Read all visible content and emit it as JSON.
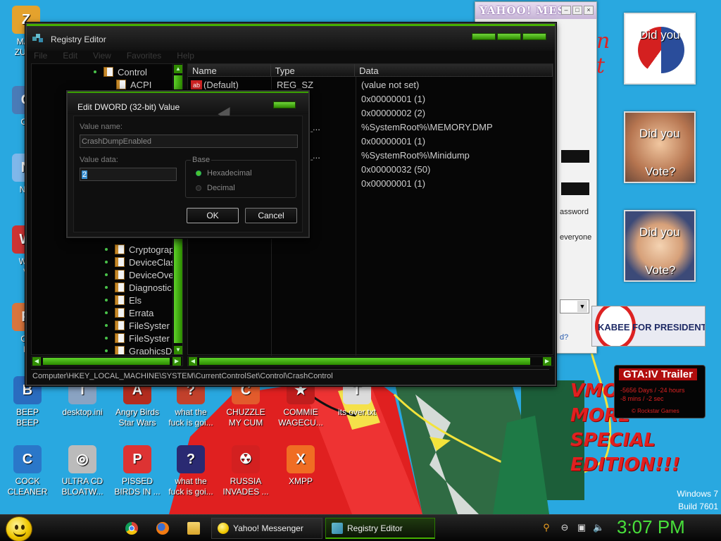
{
  "desktop": {
    "icons": [
      {
        "label": "MAR\nZUCK",
        "color": "#e4a22d",
        "glyph": "Z"
      },
      {
        "label": "Co",
        "color": "#4a7bb7",
        "glyph": "C"
      },
      {
        "label": "Net",
        "color": "#7fb7ea",
        "glyph": "N"
      },
      {
        "label": "Win\nV",
        "color": "#c33",
        "glyph": "W"
      },
      {
        "label": "Co\nP",
        "color": "#d8753d",
        "glyph": "P"
      },
      {
        "label": "BEEP\nBEEP",
        "color": "#2a6cbf",
        "glyph": "B"
      },
      {
        "label": "desktop.ini",
        "color": "#8aa3c2",
        "glyph": "i"
      },
      {
        "label": "Angry Birds\nStar Wars",
        "color": "#b32d1f",
        "glyph": "A"
      },
      {
        "label": "what the\nfuck is goi...",
        "color": "#c2412c",
        "glyph": "?"
      },
      {
        "label": "CHUZZLE\nMY CUM",
        "color": "#e35b2c",
        "glyph": "C"
      },
      {
        "label": "COMMIE\nWAGECU...",
        "color": "#c01d1d",
        "glyph": "★"
      },
      {
        "label": "its over.txt",
        "color": "#dcdcdc",
        "glyph": "T"
      },
      {
        "label": "COCK\nCLEANER",
        "color": "#2a77c9",
        "glyph": "C"
      },
      {
        "label": "ULTRA CD\nBLOATW...",
        "color": "#bbb",
        "glyph": "◎"
      },
      {
        "label": "PISSED\nBIRDS IN ...",
        "color": "#d33",
        "glyph": "P"
      },
      {
        "label": "what the\nfuck is goi...",
        "color": "#2a2a72",
        "glyph": "?"
      },
      {
        "label": "RUSSIA\nINVADES ...",
        "color": "#d32020",
        "glyph": "☢"
      },
      {
        "label": "XMPP",
        "color": "#f06d23",
        "glyph": "X"
      }
    ],
    "overlay_text": [
      "VMO",
      "MORE",
      "SPECIAL",
      "EDITION!!!"
    ],
    "gadgets": {
      "pictures": [
        "Did you",
        "Did you",
        "Vote?",
        "Did you",
        "Vote?"
      ],
      "campaign": "KABEE FOR PRESIDENT",
      "gta_title": "GTA:IV Trailer",
      "gta_lines": [
        "-5656 Days / -24 hours",
        "-8 mins / -2 sec",
        "© Rockstar Games"
      ]
    },
    "winver_1": "Windows 7",
    "winver_2": "Build 7601"
  },
  "yahoo": {
    "title": "YAHOO! MES",
    "fragments": [
      "n t",
      "assword",
      "everyone",
      "d?"
    ]
  },
  "regedit": {
    "title": "Registry Editor",
    "menu": [
      "File",
      "Edit",
      "View",
      "Favorites",
      "Help"
    ],
    "tree": [
      "Control",
      "ACPI",
      "Cryptograp",
      "DeviceClas",
      "DeviceOve",
      "Diagnostic",
      "Els",
      "Errata",
      "FileSyster",
      "FileSyster",
      "GraphicsD"
    ],
    "columns": [
      "Name",
      "Type",
      "Data"
    ],
    "rows": [
      {
        "name": "(Default)",
        "type": "REG_SZ",
        "data": "(value not set)"
      },
      {
        "name": "",
        "type": "WORD",
        "data": "0x00000001 (1)"
      },
      {
        "name": "",
        "type": "WORD",
        "data": "0x00000002 (2)"
      },
      {
        "name": "",
        "type": "XPAND_...",
        "data": "%SystemRoot%\\MEMORY.DMP"
      },
      {
        "name": "",
        "type": "WORD",
        "data": "0x00000001 (1)"
      },
      {
        "name": "",
        "type": "XPAND_...",
        "data": "%SystemRoot%\\Minidump"
      },
      {
        "name": "",
        "type": "WORD",
        "data": "0x00000032 (50)"
      },
      {
        "name": "",
        "type": "WORD",
        "data": "0x00000001 (1)"
      }
    ],
    "status": "Computer\\HKEY_LOCAL_MACHINE\\SYSTEM\\CurrentControlSet\\Control\\CrashControl"
  },
  "dialog": {
    "title": "Edit DWORD (32-bit) Value",
    "value_name_label": "Value name:",
    "value_name": "CrashDumpEnabled",
    "value_data_label": "Value data:",
    "value_data": "2",
    "base_label": "Base",
    "hex_label": "Hexadecimal",
    "dec_label": "Decimal",
    "ok": "OK",
    "cancel": "Cancel",
    "selected_base": "Hexadecimal"
  },
  "taskbar": {
    "buttons": [
      "Yahoo! Messenger",
      "Registry Editor"
    ],
    "clock": "3:07 PM",
    "colors": {
      "clock": "#48e03a",
      "accent": "#46b000"
    }
  }
}
